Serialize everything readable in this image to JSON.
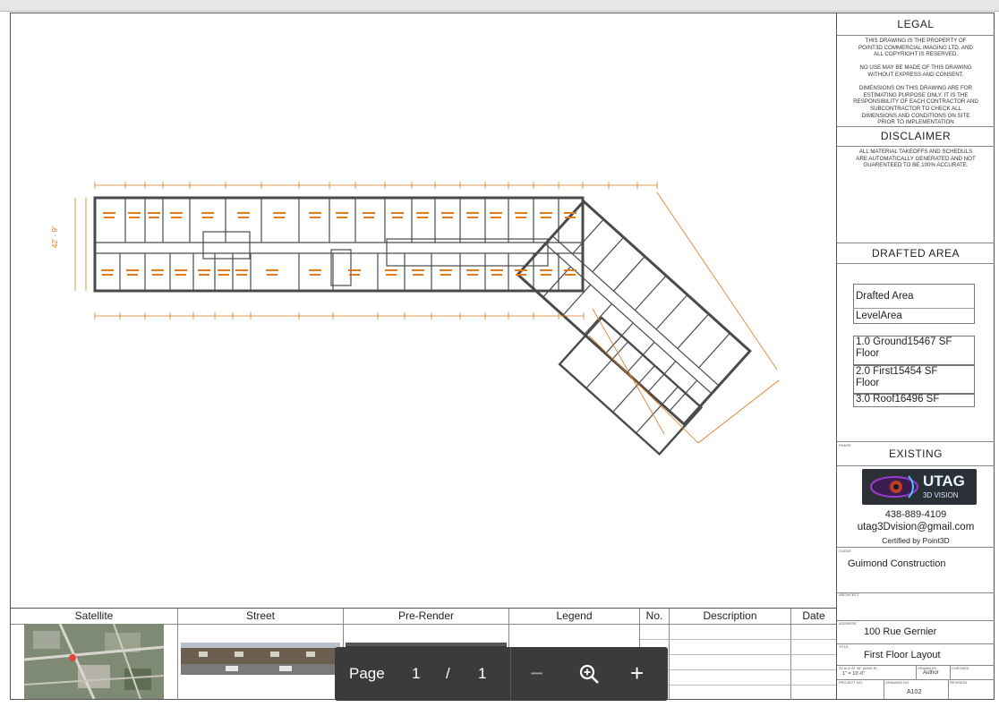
{
  "legal": {
    "title": "LEGAL",
    "lines": [
      "THIS DRAWING IS THE PROPERTY OF",
      "POINT3D COMMERCIAL IMAGING LTD. AND",
      "ALL COPYRIGHT IS RESERVED.",
      "",
      "NO USE MAY BE MADE OF THIS DRAWING",
      "WITHOUT EXPRESS AND CONSENT.",
      "",
      "DIMENSIONS ON THIS DRAWING ARE FOR",
      "ESTIMATING PURPOSE ONLY. IT IS THE",
      "RESPONSIBILITY OF EACH CONTRACTOR AND",
      "SUBCONTRACTOR TO CHECK ALL",
      "DIMENSIONS AND CONDITIONS ON SITE",
      "PRIOR TO IMPLEMENTATION"
    ]
  },
  "disclaimer": {
    "title": "DISCLAIMER",
    "lines": [
      "ALL MATERIAL TAKEOFFS AND SCHEDULS",
      "ARE AUTOMATICALLY GENERATED AND NOT",
      "GUARENTEED TO BE 100% ACCURATE."
    ]
  },
  "drafted_area": {
    "title": "DRAFTED AREA",
    "header_col1": "Drafted Area",
    "header_col2": "LevelArea",
    "floors": [
      {
        "level": "1.0 Ground",
        "area": "15467 SF",
        "suffix": "Floor"
      },
      {
        "level": "2.0 First",
        "area": "15454 SF",
        "suffix": "Floor"
      },
      {
        "level": "3.0 Roof",
        "area": "16496 SF",
        "suffix": ""
      }
    ]
  },
  "phase": {
    "label": "PHASE",
    "value": "EXISTING"
  },
  "company": {
    "logo_text_main": "UTAG",
    "logo_text_sub": "3D VISION",
    "phone": "438-889-4109",
    "email": "utag3Dvision@gmail.com",
    "certified": "Certified by Point3D"
  },
  "client": {
    "label": "CLIENT",
    "value": "Guimond Construction"
  },
  "architect": {
    "label": "ARCHITECT"
  },
  "address": {
    "label": "ADDRESS",
    "value": "100 Rue Gernier"
  },
  "drawing_title": {
    "label": "TITLE",
    "value": "First Floor Layout"
  },
  "scale": {
    "label": "SCALE AT 36\" (ANSI E)",
    "value": "1\" = 10'-0\"",
    "drawn_label": "DRAWN BY",
    "drawn_value": "Author",
    "checked_label": "CHECKED"
  },
  "project": {
    "project_label": "PROJECT NO.",
    "drawing_label": "DRAWING NO.",
    "drawing_value": "A102",
    "revision_label": "REVISION"
  },
  "bottom_strip": {
    "satellite": "Satellite",
    "street": "Street",
    "prerender": "Pre-Render",
    "legend": "Legend",
    "no": "No.",
    "description": "Description",
    "date": "Date"
  },
  "plan": {
    "overall_dim": "42' - 9\"",
    "dim_color": "#e07a1f",
    "wall_color": "#4a4a4a"
  },
  "pager": {
    "page_label": "Page",
    "current": "1",
    "slash": "/",
    "total": "1",
    "zoom_out": "−",
    "zoom_in": "+"
  }
}
